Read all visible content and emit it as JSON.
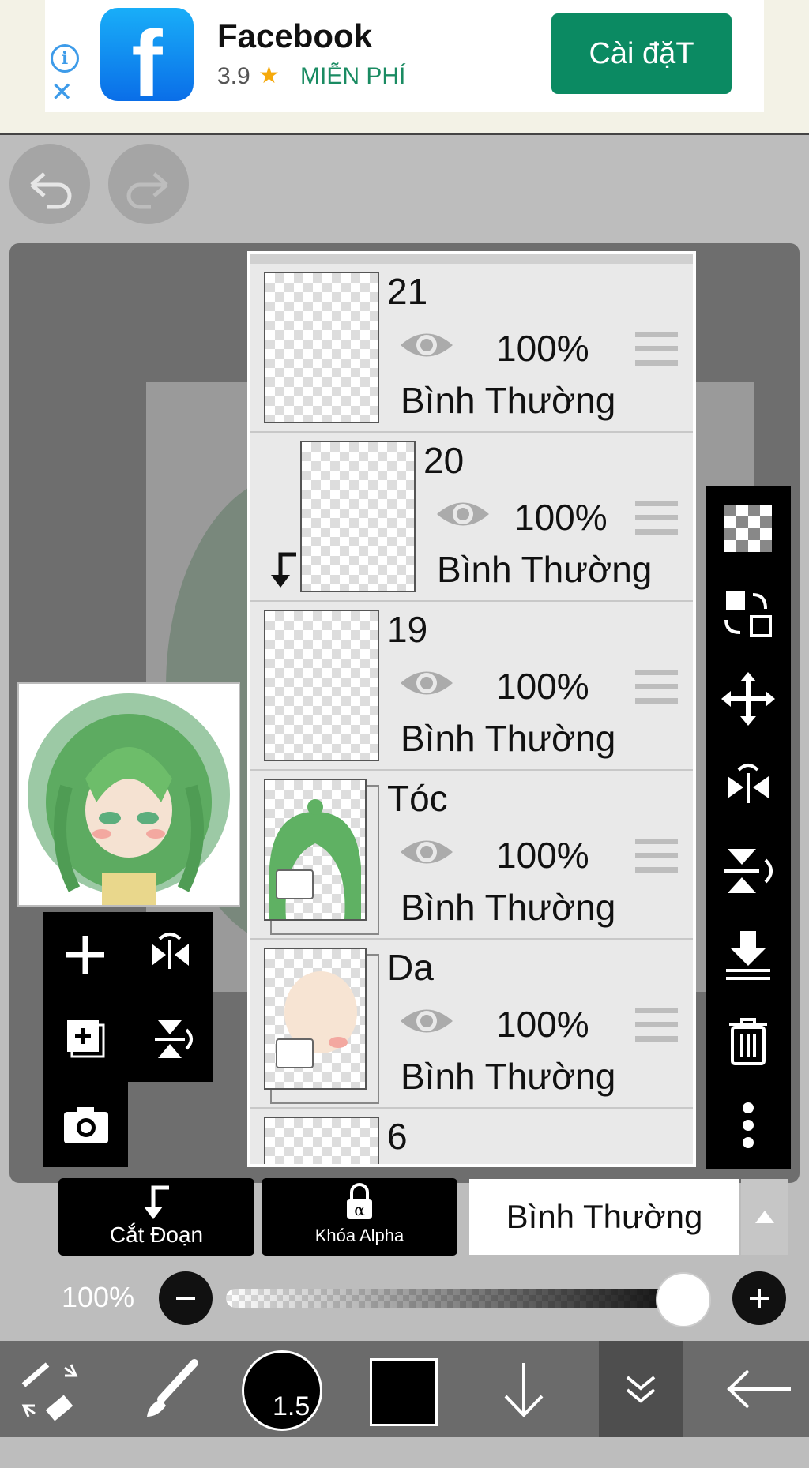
{
  "ad": {
    "app_name": "Facebook",
    "rating": "3.9",
    "star": "★",
    "price": "MIỄN PHÍ",
    "install_label": "Cài đặT",
    "logo_letter": "f",
    "info_glyph": "i",
    "close_glyph": "✕"
  },
  "layers": [
    {
      "name": "21",
      "opacity": "100%",
      "blend": "Bình Thường",
      "clipped": false,
      "folder": false
    },
    {
      "name": "20",
      "opacity": "100%",
      "blend": "Bình Thường",
      "clipped": true,
      "folder": false
    },
    {
      "name": "19",
      "opacity": "100%",
      "blend": "Bình Thường",
      "clipped": false,
      "folder": false
    },
    {
      "name": "Tóc",
      "opacity": "100%",
      "blend": "Bình Thường",
      "clipped": false,
      "folder": true
    },
    {
      "name": "Da",
      "opacity": "100%",
      "blend": "Bình Thường",
      "clipped": false,
      "folder": true
    },
    {
      "name": "6",
      "opacity": "",
      "blend": "",
      "clipped": false,
      "folder": false
    }
  ],
  "layer_controls": {
    "clipping_label": "Cắt Đoạn",
    "alpha_lock_label": "Khóa Alpha",
    "blend_mode": "Bình Thường"
  },
  "opacity": {
    "label": "100%",
    "value": 1.0
  },
  "brush": {
    "size": "1.5"
  },
  "colors": {
    "current_color": "#000000",
    "install_button": "#0b8a62"
  },
  "icons": {
    "undo": "undo-icon",
    "redo": "redo-icon",
    "add_layer": "plus-icon",
    "flip_h": "flip-horizontal-icon",
    "add_copy": "duplicate-layer-icon",
    "flip_v": "flip-vertical-icon",
    "camera": "camera-icon",
    "transparent": "checkerboard-icon",
    "swap": "swap-layer-icon",
    "move": "move-icon",
    "mirror": "mirror-icon",
    "flip_rotate": "flip-rotate-icon",
    "merge_down": "merge-down-icon",
    "delete": "trash-icon",
    "more": "more-vertical-icon"
  }
}
